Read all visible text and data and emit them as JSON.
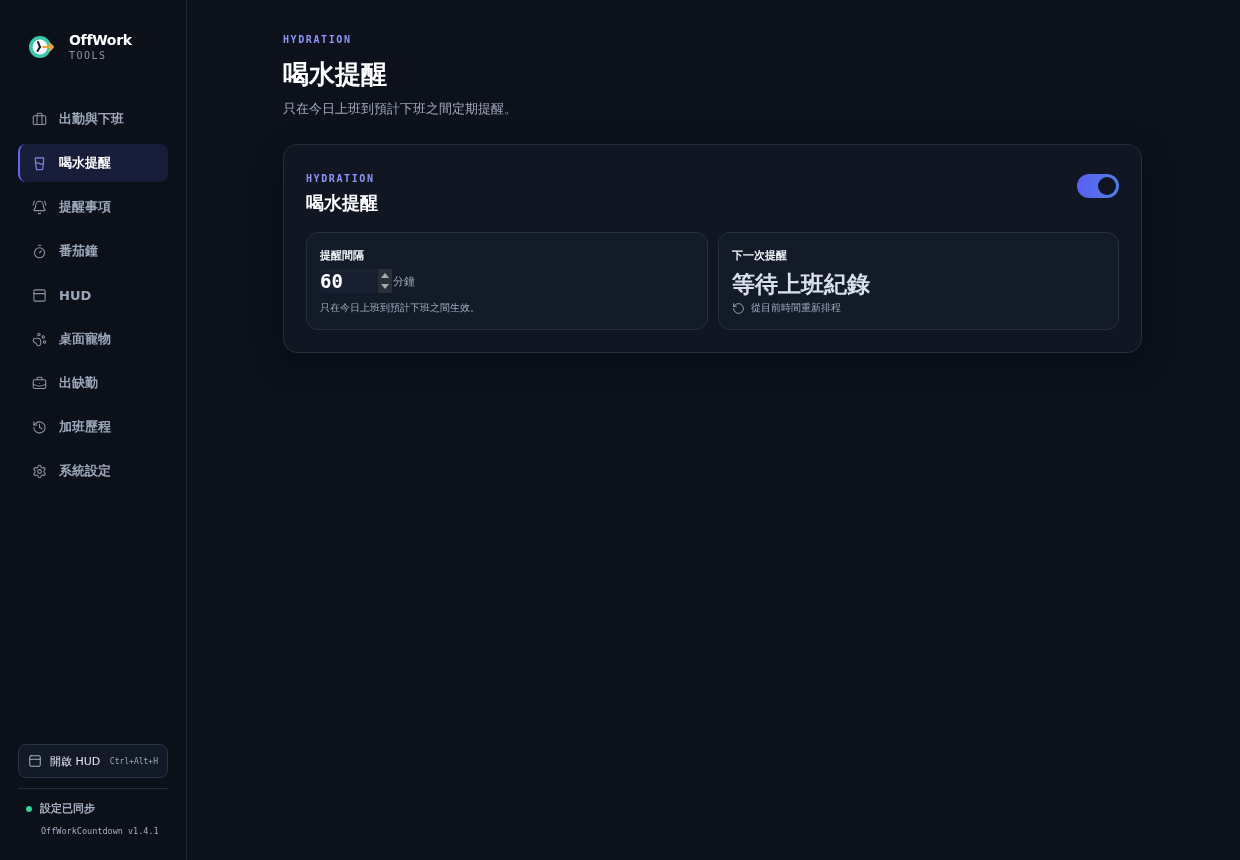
{
  "app": {
    "name": "OffWork",
    "tagline": "TOOLS"
  },
  "sidebar": {
    "items": [
      {
        "label": "出勤與下班",
        "selected": false
      },
      {
        "label": "喝水提醒",
        "selected": true
      },
      {
        "label": "提醒事項",
        "selected": false
      },
      {
        "label": "番茄鐘",
        "selected": false
      },
      {
        "label": "HUD",
        "selected": false
      },
      {
        "label": "桌面寵物",
        "selected": false
      },
      {
        "label": "出缺勤",
        "selected": false
      },
      {
        "label": "加班歷程",
        "selected": false
      },
      {
        "label": "系統設定",
        "selected": false
      }
    ]
  },
  "hud_button": {
    "label": "開啟 HUD",
    "shortcut": "Ctrl+Alt+H"
  },
  "sync_status": {
    "label": "設定已同步",
    "synced": true
  },
  "version": "OffWorkCountdown v1.4.1",
  "page": {
    "eyebrow": "HYDRATION",
    "title": "喝水提醒",
    "subtitle": "只在今日上班到預計下班之間定期提醒。"
  },
  "card": {
    "eyebrow": "HYDRATION",
    "title": "喝水提醒",
    "enabled": true,
    "interval": {
      "label": "提醒間隔",
      "value": "60",
      "unit": "分鐘",
      "hint": "只在今日上班到預計下班之間生效。"
    },
    "next": {
      "label": "下一次提醒",
      "value": "等待上班紀錄",
      "action": "從目前時間重新排程"
    }
  }
}
